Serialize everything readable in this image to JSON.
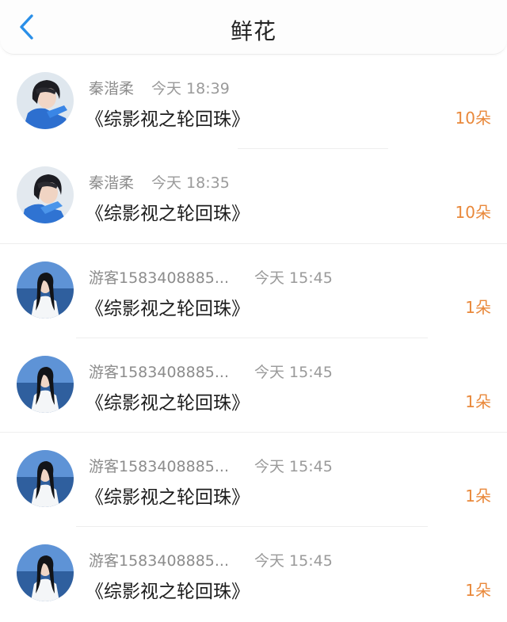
{
  "header": {
    "title": "鲜花",
    "back_icon": "chevron-left-icon"
  },
  "colors": {
    "accent_orange": "#e9883a",
    "back_blue": "#2a8fe8"
  },
  "records": [
    {
      "user": "秦湝柔",
      "time": "今天 18:39",
      "book": "《综影视之轮回珠》",
      "flowers": "10朵",
      "avatar": "portrait-blue-outfit"
    },
    {
      "user": "秦湝柔",
      "time": "今天 18:35",
      "book": "《综影视之轮回珠》",
      "flowers": "10朵",
      "avatar": "portrait-blue-outfit"
    },
    {
      "user": "游客1583408885...",
      "time": "今天 15:45",
      "book": "《综影视之轮回珠》",
      "flowers": "1朵",
      "avatar": "portrait-seaside"
    },
    {
      "user": "游客1583408885...",
      "time": "今天 15:45",
      "book": "《综影视之轮回珠》",
      "flowers": "1朵",
      "avatar": "portrait-seaside"
    },
    {
      "user": "游客1583408885...",
      "time": "今天 15:45",
      "book": "《综影视之轮回珠》",
      "flowers": "1朵",
      "avatar": "portrait-seaside"
    },
    {
      "user": "游客1583408885...",
      "time": "今天 15:45",
      "book": "《综影视之轮回珠》",
      "flowers": "1朵",
      "avatar": "portrait-seaside"
    }
  ]
}
